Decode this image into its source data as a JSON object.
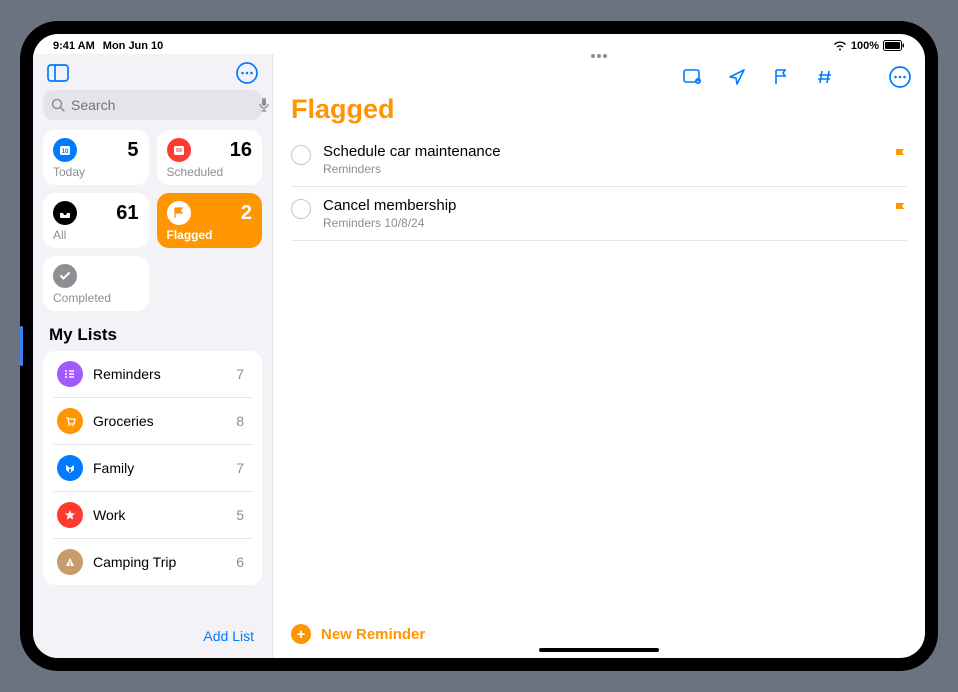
{
  "status": {
    "time": "9:41 AM",
    "date": "Mon Jun 10",
    "battery": "100%"
  },
  "search": {
    "placeholder": "Search"
  },
  "smart": {
    "today": {
      "label": "Today",
      "count": "5"
    },
    "scheduled": {
      "label": "Scheduled",
      "count": "16"
    },
    "all": {
      "label": "All",
      "count": "61"
    },
    "flagged": {
      "label": "Flagged",
      "count": "2"
    },
    "completed": {
      "label": "Completed"
    }
  },
  "sections": {
    "my_lists": "My Lists"
  },
  "lists": [
    {
      "name": "Reminders",
      "count": "7",
      "color": "#a259ff"
    },
    {
      "name": "Groceries",
      "count": "8",
      "color": "#ff9500"
    },
    {
      "name": "Family",
      "count": "7",
      "color": "#007aff"
    },
    {
      "name": "Work",
      "count": "5",
      "color": "#ff3b30"
    },
    {
      "name": "Camping Trip",
      "count": "6",
      "color": "#c69c6d"
    }
  ],
  "sidebar_footer": {
    "add_list": "Add List"
  },
  "main": {
    "title": "Flagged",
    "new_reminder": "New Reminder"
  },
  "reminders": [
    {
      "title": "Schedule car maintenance",
      "subtitle": "Reminders"
    },
    {
      "title": "Cancel membership",
      "subtitle": "Reminders  10/8/24"
    }
  ]
}
